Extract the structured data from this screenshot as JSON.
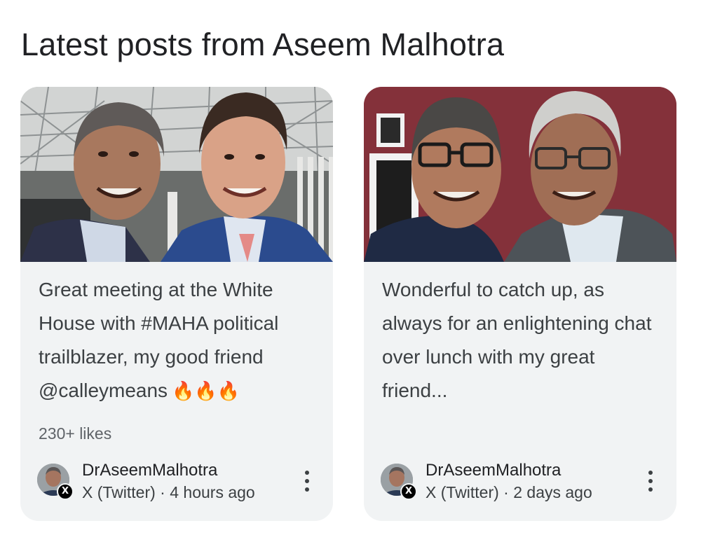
{
  "section": {
    "title": "Latest posts from Aseem Malhotra"
  },
  "posts": [
    {
      "text": "Great meeting at the White House with #MAHA political trailblazer, my good friend @calleymeans",
      "emoji": "🔥🔥🔥",
      "likes": "230+ likes",
      "author": "DrAseemMalhotra",
      "source": "X (Twitter)",
      "separator": " · ",
      "time": "4 hours ago",
      "badge_icon": "x-logo-icon",
      "badge_glyph": "X"
    },
    {
      "text": "Wonderful to catch up, as always for an enlightening chat over lunch with my great friend...",
      "emoji": "",
      "likes": "",
      "author": "DrAseemMalhotra",
      "source": "X (Twitter)",
      "separator": " · ",
      "time": "2 days ago",
      "badge_icon": "x-logo-icon",
      "badge_glyph": "X"
    }
  ],
  "colors": {
    "card_bg": "#f1f3f4",
    "title_text": "#202124",
    "body_text": "#3c4043",
    "secondary_text": "#5f6368"
  }
}
